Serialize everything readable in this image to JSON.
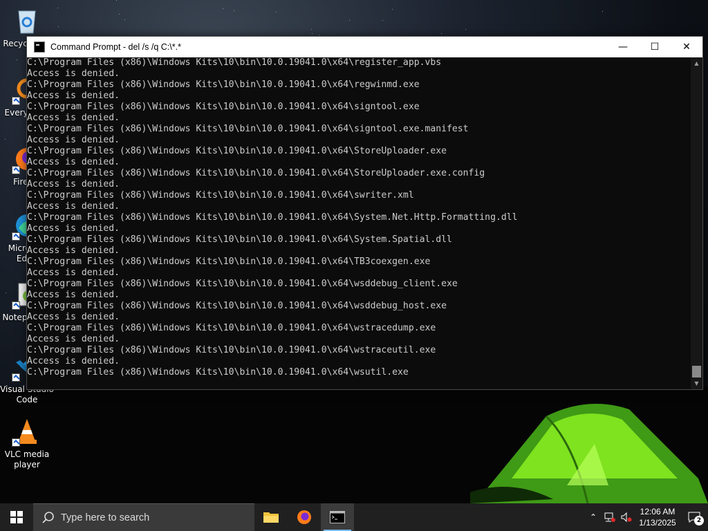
{
  "desktop": {
    "icons": [
      {
        "label": "Recycle Bin",
        "icon": "recycle-bin-icon"
      },
      {
        "label": "Everything",
        "icon": "everything-icon"
      },
      {
        "label": "Firefox",
        "icon": "firefox-icon"
      },
      {
        "label": "Microsoft Edge",
        "icon": "edge-icon"
      },
      {
        "label": "Notepad++",
        "icon": "notepadpp-icon"
      },
      {
        "label": "Visual Studio Code",
        "icon": "vscode-icon"
      },
      {
        "label": "VLC media player",
        "icon": "vlc-icon"
      }
    ]
  },
  "window": {
    "title": "Command Prompt - del  /s /q C:\\*.*",
    "minimize": "—",
    "maximize": "☐",
    "close": "✕",
    "lines": [
      "C:\\Program Files (x86)\\Windows Kits\\10\\bin\\10.0.19041.0\\x64\\register_app.vbs",
      "Access is denied.",
      "C:\\Program Files (x86)\\Windows Kits\\10\\bin\\10.0.19041.0\\x64\\regwinmd.exe",
      "Access is denied.",
      "C:\\Program Files (x86)\\Windows Kits\\10\\bin\\10.0.19041.0\\x64\\signtool.exe",
      "Access is denied.",
      "C:\\Program Files (x86)\\Windows Kits\\10\\bin\\10.0.19041.0\\x64\\signtool.exe.manifest",
      "Access is denied.",
      "C:\\Program Files (x86)\\Windows Kits\\10\\bin\\10.0.19041.0\\x64\\StoreUploader.exe",
      "Access is denied.",
      "C:\\Program Files (x86)\\Windows Kits\\10\\bin\\10.0.19041.0\\x64\\StoreUploader.exe.config",
      "Access is denied.",
      "C:\\Program Files (x86)\\Windows Kits\\10\\bin\\10.0.19041.0\\x64\\swriter.xml",
      "Access is denied.",
      "C:\\Program Files (x86)\\Windows Kits\\10\\bin\\10.0.19041.0\\x64\\System.Net.Http.Formatting.dll",
      "Access is denied.",
      "C:\\Program Files (x86)\\Windows Kits\\10\\bin\\10.0.19041.0\\x64\\System.Spatial.dll",
      "Access is denied.",
      "C:\\Program Files (x86)\\Windows Kits\\10\\bin\\10.0.19041.0\\x64\\TB3coexgen.exe",
      "Access is denied.",
      "C:\\Program Files (x86)\\Windows Kits\\10\\bin\\10.0.19041.0\\x64\\wsddebug_client.exe",
      "Access is denied.",
      "C:\\Program Files (x86)\\Windows Kits\\10\\bin\\10.0.19041.0\\x64\\wsddebug_host.exe",
      "Access is denied.",
      "C:\\Program Files (x86)\\Windows Kits\\10\\bin\\10.0.19041.0\\x64\\wstracedump.exe",
      "Access is denied.",
      "C:\\Program Files (x86)\\Windows Kits\\10\\bin\\10.0.19041.0\\x64\\wstraceutil.exe",
      "Access is denied.",
      "C:\\Program Files (x86)\\Windows Kits\\10\\bin\\10.0.19041.0\\x64\\wsutil.exe"
    ]
  },
  "taskbar": {
    "search_placeholder": "Type here to search",
    "time": "12:06 AM",
    "date": "1/13/2025",
    "notification_count": "2"
  }
}
